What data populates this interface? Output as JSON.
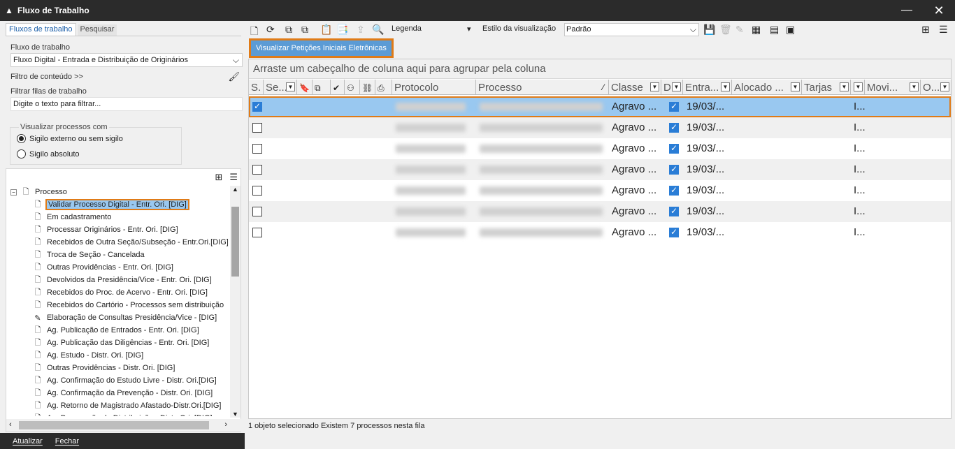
{
  "window": {
    "title": "Fluxo de Trabalho",
    "minimize": "—",
    "close": "✕"
  },
  "left": {
    "tabs": [
      "Fluxos de trabalho",
      "Pesquisar"
    ],
    "fluxo_label": "Fluxo de trabalho",
    "fluxo_value": "Fluxo Digital - Entrada e Distribuição de Originários",
    "filtro_conteudo": "Filtro de conteúdo >>",
    "filtrar_filas_label": "Filtrar filas de trabalho",
    "filtrar_placeholder": "Digite o texto para filtrar...",
    "visualizar_legend": "Visualizar processos com",
    "radio_options": [
      "Sigilo externo ou sem sigilo",
      "Sigilo absoluto"
    ],
    "radio_selected": 0,
    "tree_root": "Processo",
    "tree_items": [
      "Validar Processo Digital - Entr. Ori. [DIG]",
      "Em cadastramento",
      "Processar Originários - Entr. Ori. [DIG]",
      "Recebidos de Outra Seção/Subseção - Entr.Ori.[DIG]",
      "Troca de Seção - Cancelada",
      "Outras Providências - Entr. Ori. [DIG]",
      "Devolvidos da Presidência/Vice - Entr. Ori. [DIG]",
      "Recebidos do Proc. de Acervo - Entr. Ori. [DIG]",
      "Recebidos do Cartório - Processos sem distribuição",
      "Elaboração de Consultas Presidência/Vice - [DIG]",
      "Ag. Publicação de Entrados - Entr. Ori. [DIG]",
      "Ag. Publicação das Diligências - Entr. Ori. [DIG]",
      "Ag. Estudo - Distr. Ori. [DIG]",
      "Outras Providências - Distr. Ori. [DIG]",
      "Ag. Confirmação do Estudo Livre - Distr. Ori.[DIG]",
      "Ag. Confirmação da Prevenção - Distr. Ori. [DIG]",
      "Ag. Retorno de Magistrado Afastado-Distr.Ori.[DIG]",
      "Ag. Preparação da Distribuição - Distr. Ori. [DIG]"
    ],
    "selected_index": 0,
    "bottom_buttons": [
      "Atualizar",
      "Fechar"
    ]
  },
  "toolbar": {
    "legenda": "Legenda",
    "estilo_label": "Estilo da visualização",
    "estilo_value": "Padrão"
  },
  "action_button": "Visualizar Petições Iniciais Eletrônicas",
  "grid": {
    "group_hint": "Arraste um cabeçalho de coluna aqui para agrupar pela coluna",
    "columns": [
      "S.",
      "Se...",
      "Protocolo",
      "Processo",
      "Classe",
      "D",
      "Entra...",
      "Alocado ...",
      "Tarjas",
      "Movi...",
      "O..."
    ],
    "rows": [
      {
        "classe": "Agravo ...",
        "entrada": "19/03/...",
        "movi": "I..."
      },
      {
        "classe": "Agravo ...",
        "entrada": "19/03/...",
        "movi": "I..."
      },
      {
        "classe": "Agravo ...",
        "entrada": "19/03/...",
        "movi": "I..."
      },
      {
        "classe": "Agravo ...",
        "entrada": "19/03/...",
        "movi": "I..."
      },
      {
        "classe": "Agravo ...",
        "entrada": "19/03/...",
        "movi": "I..."
      },
      {
        "classe": "Agravo ...",
        "entrada": "19/03/...",
        "movi": "I..."
      },
      {
        "classe": "Agravo ...",
        "entrada": "19/03/...",
        "movi": "I..."
      }
    ],
    "selected_row": 0
  },
  "status": "1 objeto selecionado  Existem 7 processos nesta fila",
  "colors": {
    "accent": "#e07b17",
    "selection": "#99c8f0",
    "button": "#5b9bd5",
    "titlebar": "#2b2b2b"
  }
}
